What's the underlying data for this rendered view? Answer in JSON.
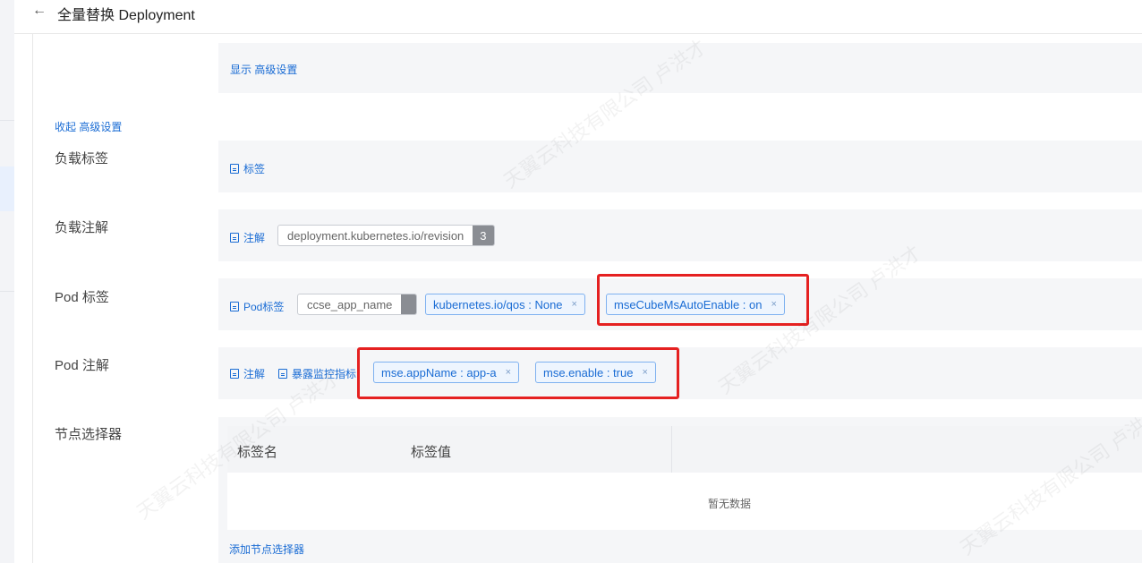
{
  "header": {
    "back_icon": "←",
    "title": "全量替换 Deployment"
  },
  "advanced": {
    "show_link": "显示 高级设置",
    "collapse_link": "收起 高级设置"
  },
  "sections": {
    "workload_labels": {
      "label": "负载标签",
      "add_link": "标签"
    },
    "workload_annotations": {
      "label": "负载注解",
      "add_link": "注解",
      "tag": {
        "key": "deployment.kubernetes.io/revision",
        "value": "3"
      }
    },
    "pod_labels": {
      "label": "Pod 标签",
      "add_link": "Pod标签",
      "gray_tag_key": "ccse_app_name",
      "tags": [
        "kubernetes.io/qos : None",
        "mseCubeMsAutoEnable : on"
      ]
    },
    "pod_annotations": {
      "label": "Pod 注解",
      "add_link": "注解",
      "expose_link": "暴露监控指标",
      "tags": [
        "mse.appName : app-a",
        "mse.enable : true"
      ]
    },
    "node_selector": {
      "label": "节点选择器",
      "columns": [
        "标签名",
        "标签值"
      ],
      "empty_text": "暂无数据",
      "add_link": "添加节点选择器"
    }
  },
  "tag_close_glyph": "×",
  "watermark": "天翼云科技有限公司 卢洪才",
  "colors": {
    "link": "#1a6cd4",
    "highlight": "#e52121",
    "panel": "#f5f6f8"
  }
}
